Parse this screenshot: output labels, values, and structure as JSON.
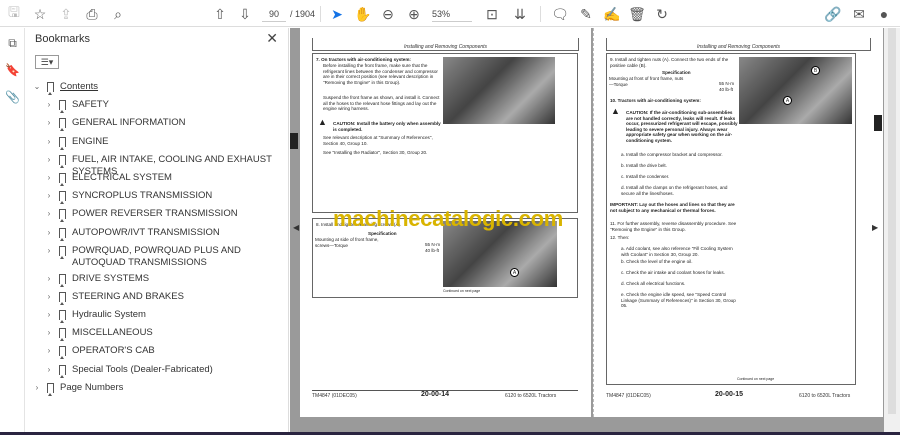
{
  "toolbar": {
    "page_current": "90",
    "page_total": "/ 1904",
    "zoom": "53%"
  },
  "bookmarks": {
    "title": "Bookmarks",
    "items": [
      {
        "label": "Contents",
        "expanded": true,
        "link": true
      },
      {
        "label": "SAFETY"
      },
      {
        "label": "GENERAL INFORMATION"
      },
      {
        "label": "ENGINE"
      },
      {
        "label": "FUEL, AIR INTAKE, COOLING AND EXHAUST SYSTEMS"
      },
      {
        "label": "ELECTRICAL SYSTEM"
      },
      {
        "label": "SYNCROPLUS TRANSMISSION"
      },
      {
        "label": "POWER REVERSER TRANSMISSION"
      },
      {
        "label": "AUTOPOWR/IVT TRANSMISSION"
      },
      {
        "label": "POWRQUAD, POWRQUAD PLUS AND AUTOQUAD TRANSMISSIONS"
      },
      {
        "label": "DRIVE SYSTEMS"
      },
      {
        "label": "STEERING AND BRAKES"
      },
      {
        "label": "Hydraulic System"
      },
      {
        "label": "MISCELLANEOUS"
      },
      {
        "label": "OPERATOR'S CAB"
      },
      {
        "label": "Special Tools (Dealer-Fabricated)"
      },
      {
        "label": "Page Numbers",
        "top": true
      }
    ]
  },
  "watermark": "machinecatalogic.com",
  "page_left": {
    "header": "Installing and Removing Components",
    "step7_title": "7.  On tractors with air-conditioning system:",
    "step7_text": "Before installing the front frame, make sure that the refrigerant lines between the condenser and compressor are in their correct position (see relevant description in \"Removing the Engine\" in this Group).",
    "step7_text2": "Suspend the front frame as shown, and install it. Connect all the hoses to the relevant hose fittings and lay out the engine wiring harness.",
    "caution": "CAUTION: Install the battery only when assembly is completed.",
    "ref1": "See relevant description at \"Summary of References\", Section 40, Group 10.",
    "ref2": "See \"Installing the Radiator\", Section 30, Group 20.",
    "step8": "8.  Install and tighten attaching screws (A).",
    "spec_title": "Specification",
    "spec_row": "Mounting at side of front frame, screws—Torque",
    "spec_val1": "55 N·m",
    "spec_val2": "40 lb-ft",
    "continued": "Continued on next page",
    "callout": "A",
    "footer_left": "TM4847 (01DEC05)",
    "footer_num": "20-00-14",
    "footer_right": "6120 to 6520L Tractors"
  },
  "page_right": {
    "header": "Installing and Removing Components",
    "step9": "9.  Install and tighten nuts (A). Connect the two ends of the positive cable (B).",
    "spec_title": "Specification",
    "spec_row": "Mounting at front of front frame, nuts—Torque",
    "spec_val1": "55 N·m",
    "spec_val2": "40 lb-ft",
    "step10": "10.  Tractors with air-conditioning system:",
    "caution": "CAUTION: If the air-conditioning sub-assemblies are not handled correctly, leaks will result. If leaks occur, pressurized refrigerant will escape, possibly leading to severe personal injury. Always wear appropriate safety gear when working on the air-conditioning system.",
    "a": "a.  Install the compressor bracket and compressor.",
    "b": "b.  Install the drive belt.",
    "c": "c.  Install the condenser.",
    "d": "d.  Install all the clamps on the refrigerant hoses, and secure all the lines/hoses.",
    "important": "IMPORTANT:  Lay out the hoses and lines so that they are not subject to any mechanical or thermal forces.",
    "step11": "11.  For further assembly, reverse disassembly procedure. See \"Removing the Engine\" in this Group.",
    "step12": "12.  Then:",
    "e1": "a.  Add coolant, see also reference \"Fill Cooling System with Coolant\" in Section 30, Group 20.",
    "e2": "b.  Check the level of the engine oil.",
    "e3": "c.  Check the air intake and coolant hoses for leaks.",
    "e4": "d.  Check all electrical functions.",
    "e5": "e.  Check the engine idle speed, see \"Speed Control Linkage (Summary of References)\" in Section 30, Group 05.",
    "callout_a": "A",
    "callout_b": "B",
    "continued": "Continued on next page",
    "footer_left": "TM4847 (01DEC05)",
    "footer_num": "20-00-15",
    "footer_right": "6120 to 6520L Tractors"
  }
}
